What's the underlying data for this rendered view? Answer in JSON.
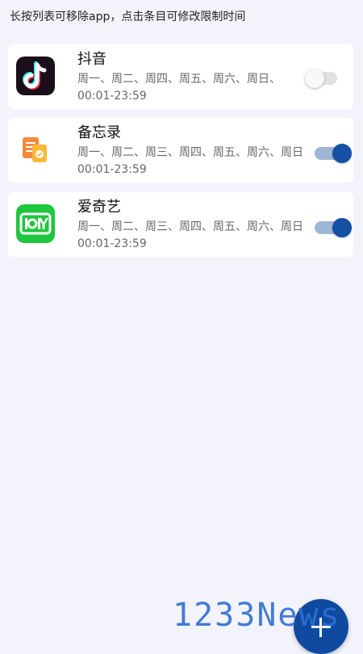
{
  "hint": "长按列表可移除app，点击条目可修改限制时间",
  "apps": [
    {
      "name": "抖音",
      "days": "周一、周二、周四、周五、周六、周日、",
      "time": "00:01-23:59",
      "icon": "douyin-icon",
      "enabled": false
    },
    {
      "name": "备忘录",
      "days": "周一、周二、周三、周四、周五、周六、周日",
      "time": "00:01-23:59",
      "icon": "memo-icon",
      "enabled": true
    },
    {
      "name": "爱奇艺",
      "days": "周一、周二、周三、周四、周五、周六、周日",
      "time": "00:01-23:59",
      "icon": "iqiyi-icon",
      "enabled": true
    }
  ],
  "fab": {
    "icon": "plus-icon"
  },
  "watermark": "1233News",
  "colors": {
    "background": "#f3f4fb",
    "accent": "#1450a3",
    "iqiyi_green": "#1ec73d",
    "douyin_dark": "#1b0f19"
  }
}
